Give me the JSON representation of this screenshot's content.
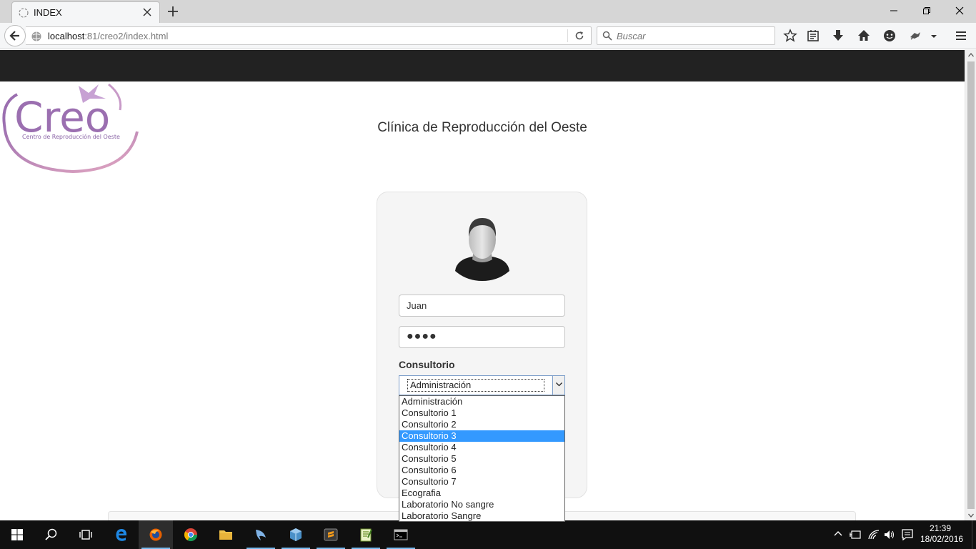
{
  "browser": {
    "tab_title": "INDEX",
    "url_host": "localhost",
    "url_rest": ":81/creo2/index.html",
    "search_placeholder": "Buscar"
  },
  "header": {
    "logo_text": "Creo",
    "logo_tagline": "Centro de Reproducción del Oeste",
    "clinic_title": "Clínica de Reproducción del Oeste"
  },
  "login": {
    "username_value": "Juan",
    "password_masked": "●●●●",
    "consultorio_label": "Consultorio",
    "consultorio_selected": "Administración",
    "consultorio_options": [
      "Administración",
      "Consultorio 1",
      "Consultorio 2",
      "Consultorio 3",
      "Consultorio 4",
      "Consultorio 5",
      "Consultorio 6",
      "Consultorio 7",
      "Ecografia",
      "Laboratorio No sangre",
      "Laboratorio Sangre"
    ],
    "highlighted_option": "Consultorio 3"
  },
  "taskbar": {
    "time": "21:39",
    "date": "18/02/2016"
  },
  "colors": {
    "top_band": "#222222",
    "option_highlight": "#3399ff",
    "logo_purple": "#9b6fb0",
    "logo_pink": "#d59ab7"
  }
}
